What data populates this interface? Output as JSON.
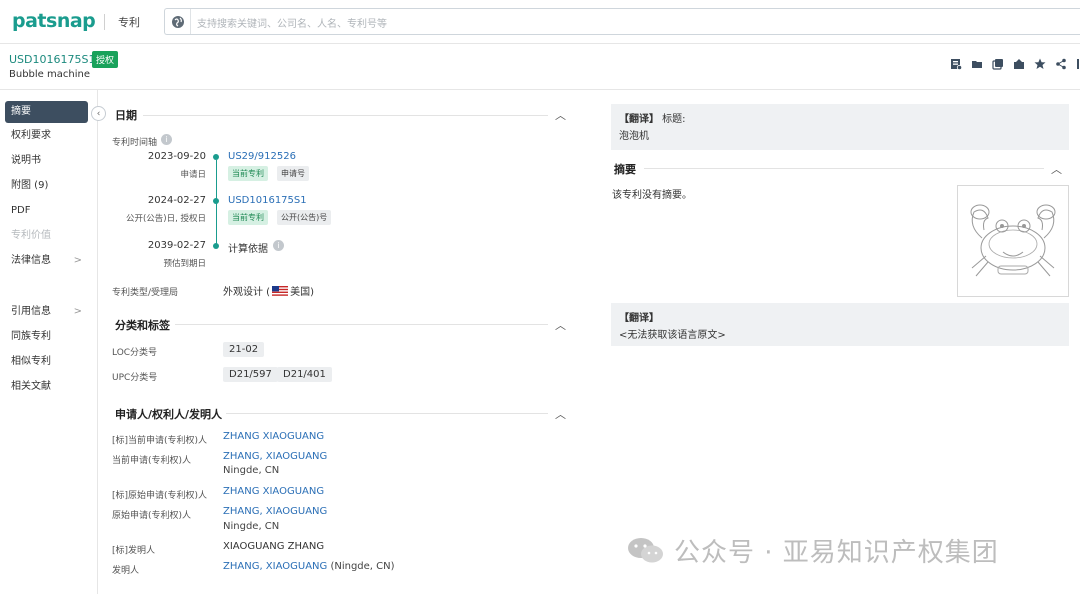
{
  "topbar": {
    "logo": "patsnap",
    "product": "专利",
    "search_placeholder": "支持搜索关键词、公司名、人名、专利号等"
  },
  "patent": {
    "number": "USD1016175S1",
    "status_badge": "授权",
    "title": "Bubble machine"
  },
  "toolbar_icons": [
    "pdf-icon",
    "folder-icon",
    "copy-icon",
    "share-box-icon",
    "star-icon",
    "share-icon"
  ],
  "sidebar": {
    "items": [
      {
        "label": "摘要",
        "state": "active"
      },
      {
        "label": "权利要求",
        "state": "normal"
      },
      {
        "label": "说明书",
        "state": "normal"
      },
      {
        "label": "附图 (9)",
        "state": "normal"
      },
      {
        "label": "PDF",
        "state": "normal"
      },
      {
        "label": "专利价值",
        "state": "disabled"
      },
      {
        "label": "法律信息",
        "state": "normal",
        "chevron": ">"
      },
      {
        "label": "引用信息",
        "state": "normal",
        "chevron": ">"
      },
      {
        "label": "同族专利",
        "state": "normal"
      },
      {
        "label": "相似专利",
        "state": "normal"
      },
      {
        "label": "相关文献",
        "state": "normal"
      }
    ]
  },
  "dates": {
    "heading": "日期",
    "timeline_label": "专利时间轴",
    "entries": [
      {
        "date": "2023-09-20",
        "sub": "申请日",
        "link": "US29/912526",
        "tags": [
          "当前专利",
          "申请号"
        ]
      },
      {
        "date": "2024-02-27",
        "sub": "公开(公告)日, 授权日",
        "link": "USD1016175S1",
        "tags": [
          "当前专利",
          "公开(公告)号"
        ]
      },
      {
        "date": "2039-02-27",
        "sub": "预估到期日",
        "text": "计算依据"
      }
    ],
    "type_label": "专利类型/受理局",
    "type_value_prefix": "外观设计 (",
    "type_value_country": "美国)"
  },
  "classification": {
    "heading": "分类和标签",
    "loc_label": "LOC分类号",
    "loc_values": [
      "21-02"
    ],
    "upc_label": "UPC分类号",
    "upc_values": [
      "D21/597",
      "D21/401"
    ]
  },
  "parties": {
    "heading": "申请人/权利人/发明人",
    "rows": [
      {
        "label": "[标]当前申请(专利权)人",
        "value": "ZHANG XIAOGUANG"
      },
      {
        "label": "当前申请(专利权)人",
        "value": "ZHANG, XIAOGUANG",
        "sub": "Ningde, CN"
      },
      {
        "label": "[标]原始申请(专利权)人",
        "value": "ZHANG XIAOGUANG"
      },
      {
        "label": "原始申请(专利权)人",
        "value": "ZHANG, XIAOGUANG",
        "sub": "Ningde, CN"
      },
      {
        "label": "[标]发明人",
        "value": "XIAOGUANG ZHANG"
      },
      {
        "label": "发明人",
        "value": "ZHANG, XIAOGUANG",
        "suffix": " (Ningde, CN)"
      }
    ]
  },
  "right": {
    "title_tag": "【翻译】",
    "title_label": " 标题:",
    "title_value": "泡泡机",
    "abstract_heading": "摘要",
    "abstract_text": "该专利没有摘要。",
    "abstract_tag": "【翻译】",
    "abstract_translation": "<无法获取该语言原文>"
  },
  "watermark": "公众号 · 亚易知识产权集团",
  "colors": {
    "brand": "#1a9c8e",
    "link": "#2b6fb6",
    "badge": "#19a25b",
    "sidebar_active": "#3d4e60"
  }
}
